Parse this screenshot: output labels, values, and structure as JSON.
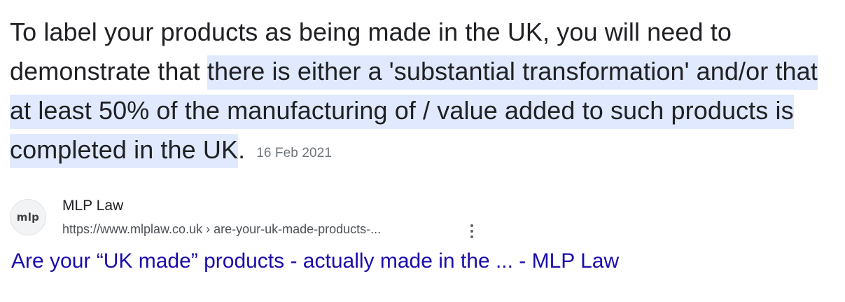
{
  "snippet": {
    "text_plain": "To label your products as being made in the UK, you will need to demonstrate that ",
    "text_highlighted": "there is either a 'substantial transformation' and/or that at least 50% of the manufacturing of / value added to such products is completed in the UK",
    "text_end": ".",
    "date": "16 Feb 2021",
    "highlight_color": "#e0e9fd"
  },
  "source": {
    "favicon_text": "mlp",
    "favicon_icon": "mlp-law-logo-icon",
    "site_name": "MLP Law",
    "url": "https://www.mlplaw.co.uk › are-your-uk-made-products-...",
    "more_icon": "more-vert-icon"
  },
  "result": {
    "title": "Are your “UK made” products - actually made in the ... - MLP Law",
    "link_color": "#1a0dab"
  }
}
